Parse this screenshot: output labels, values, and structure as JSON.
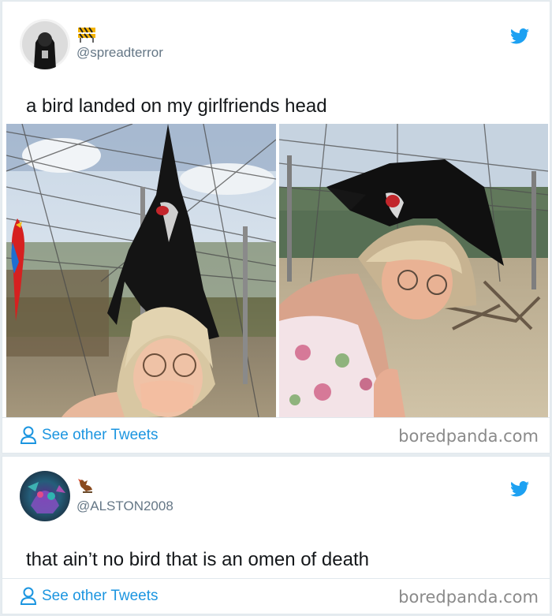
{
  "tweets": [
    {
      "handle": "@spreadterror",
      "text": "a bird landed on my girlfriends head",
      "footer_link": "See other Tweets",
      "watermark": "boredpanda.com",
      "icons": [
        "barricade-icon",
        "twitter-bird-icon",
        "person-icon"
      ]
    },
    {
      "handle": "@ALSTON2008",
      "text": "that ain’t no bird that is an omen of death",
      "footer_link": "See other Tweets",
      "watermark": "boredpanda.com",
      "icons": [
        "bird-sitting-icon",
        "twitter-bird-icon",
        "person-icon"
      ]
    }
  ],
  "colors": {
    "link": "#1b95e0",
    "twitter_blue": "#1da1f2",
    "handle_gray": "#657786",
    "text": "#14171a",
    "background": "#e6ecf0"
  }
}
